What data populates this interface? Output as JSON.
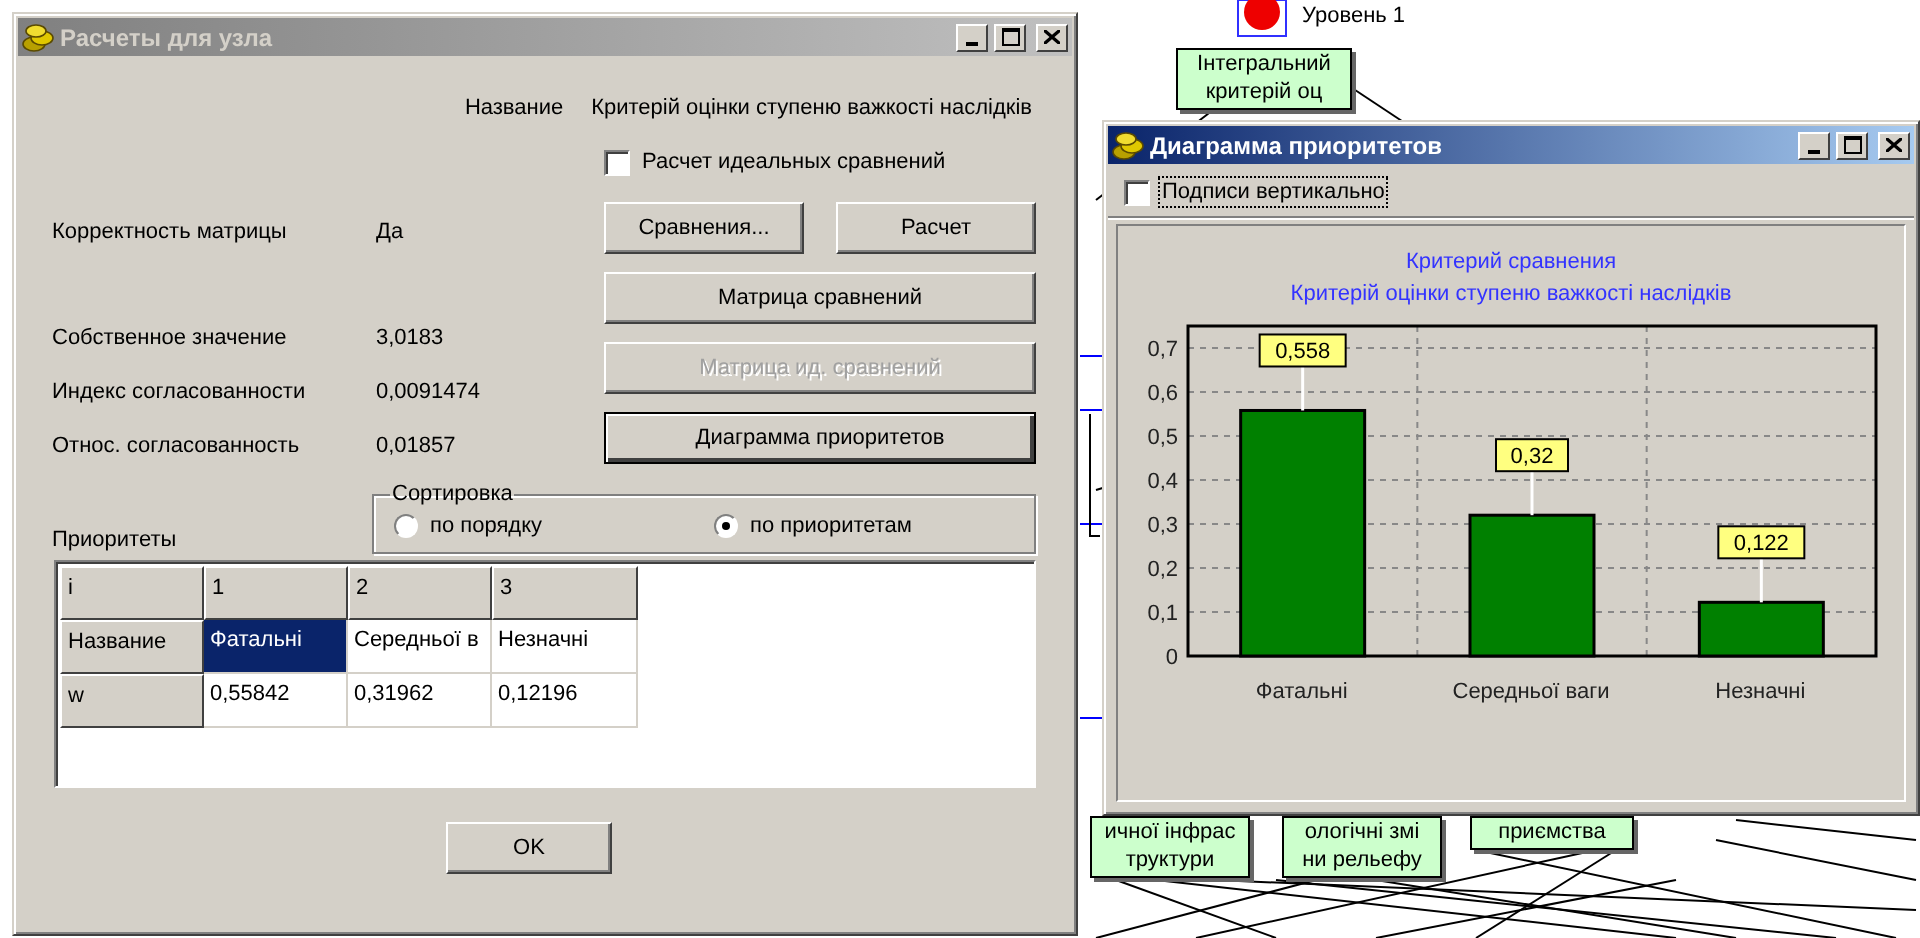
{
  "canvas": {
    "level_node": {
      "label": "Уровень 1"
    },
    "nodes": [
      {
        "lines": [
          "Інтегральний",
          "критерій оц"
        ]
      }
    ],
    "bottom_nodes": [
      {
        "lines": [
          "ичної інфрас",
          "труктури"
        ]
      },
      {
        "lines": [
          "ологічні змі",
          "ни рельефу"
        ]
      },
      {
        "lines": [
          "приємства"
        ]
      }
    ]
  },
  "node_dialog": {
    "title": "Расчеты для узла",
    "active": false,
    "name_label": "Название",
    "name_value": "Критерій оцінки ступеню важкості наслідків",
    "ideal_checkbox": {
      "label": "Расчет идеальных сравнений",
      "checked": false
    },
    "stats": [
      {
        "label": "Корректность матрицы",
        "value": "Да"
      },
      {
        "label": "Собственное значение",
        "value": "3,0183"
      },
      {
        "label": "Индекс согласованности",
        "value": "0,0091474"
      },
      {
        "label": "Относ. согласованность",
        "value": "0,01857"
      }
    ],
    "buttons": [
      {
        "label": "Сравнения...",
        "disabled": false,
        "focused": false
      },
      {
        "label": "Расчет",
        "disabled": false,
        "focused": false
      },
      {
        "label": "Матрица сравнений",
        "disabled": false,
        "focused": false
      },
      {
        "label": "Матрица ид. сравнений",
        "disabled": true,
        "focused": false
      },
      {
        "label": "Диаграмма приоритетов",
        "disabled": false,
        "focused": true
      }
    ],
    "sorting": {
      "title": "Сортировка",
      "options": [
        {
          "label": "по порядку",
          "selected": false
        },
        {
          "label": "по приоритетам",
          "selected": true
        }
      ]
    },
    "priorities_label": "Приоритеты",
    "table": {
      "columns": [
        "i",
        "1",
        "2",
        "3"
      ],
      "rows": [
        {
          "cells": [
            {
              "text": "Название",
              "kind": "header"
            },
            {
              "text": "Фатальні",
              "kind": "data",
              "selected": true
            },
            {
              "text": "Середньої в",
              "kind": "data",
              "selected": false
            },
            {
              "text": "Незначні",
              "kind": "data",
              "selected": false
            }
          ]
        },
        {
          "cells": [
            {
              "text": "w",
              "kind": "header"
            },
            {
              "text": "0,55842",
              "kind": "data",
              "selected": false
            },
            {
              "text": "0,31962",
              "kind": "data",
              "selected": false
            },
            {
              "text": "0,12196",
              "kind": "data",
              "selected": false
            }
          ]
        }
      ]
    },
    "ok_button": "OK"
  },
  "chart_window": {
    "title": "Диаграмма приоритетов",
    "active": true,
    "vertical_labels": {
      "label": "Подписи вертикально",
      "checked": false
    },
    "subtitle": "Критерій оцінки ступеню важкості наслідків",
    "chart_data": {
      "type": "bar",
      "title": "Критерий сравнения",
      "categories": [
        "Фатальні",
        "Середньої ваги",
        "Незначні"
      ],
      "values": [
        0.558,
        0.32,
        0.122
      ],
      "ylim": [
        0,
        0.75
      ],
      "grid": true,
      "yticks": [
        {
          "value": 0,
          "label": "0"
        },
        {
          "value": 0.1,
          "label": "0,1"
        },
        {
          "value": 0.2,
          "label": "0,2"
        },
        {
          "value": 0.3,
          "label": "0,3"
        },
        {
          "value": 0.4,
          "label": "0,4"
        },
        {
          "value": 0.5,
          "label": "0,5"
        },
        {
          "value": 0.6,
          "label": "0,6"
        },
        {
          "value": 0.7,
          "label": "0,7"
        }
      ],
      "value_labels": [
        "0,558",
        "0,32",
        "0,122"
      ]
    }
  }
}
